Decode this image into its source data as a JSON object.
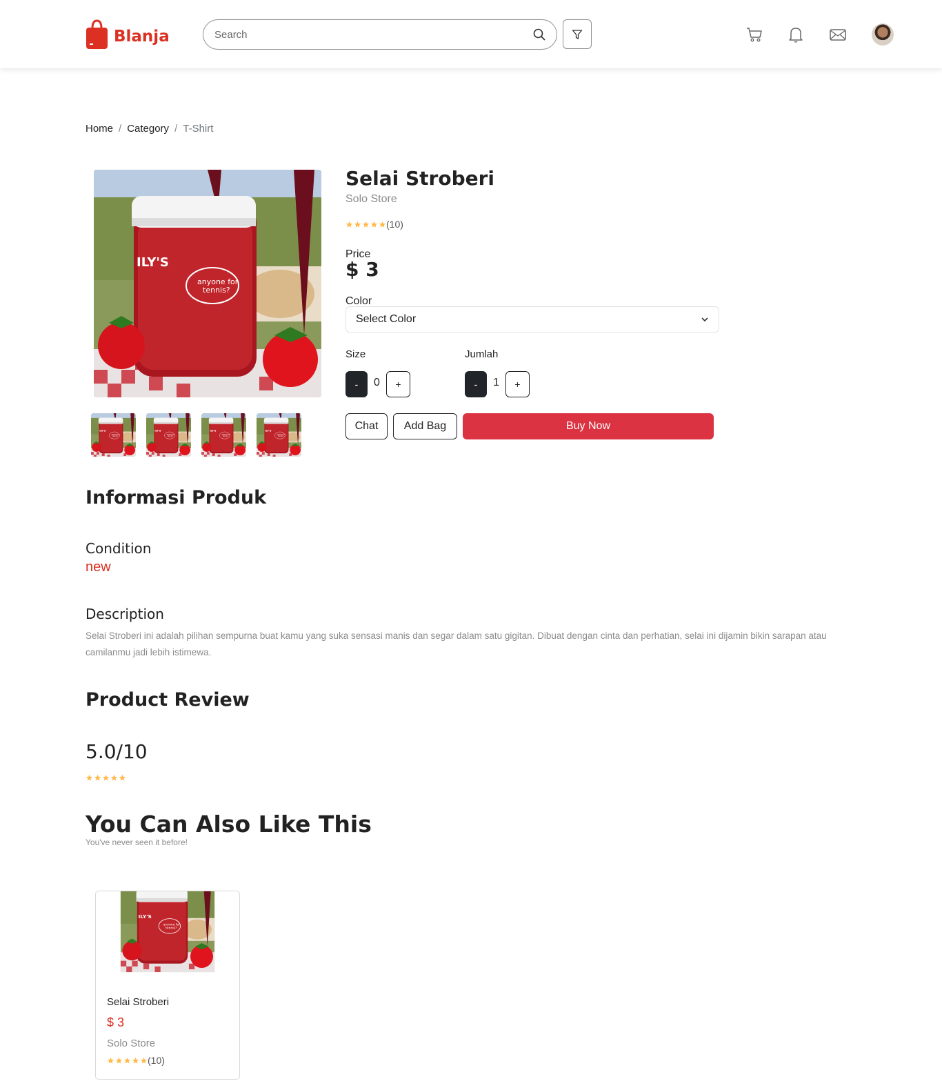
{
  "header": {
    "brand": "Blanja",
    "search": {
      "placeholder": "Search",
      "value": ""
    },
    "icons": [
      "shopping-bag-icon",
      "search-icon",
      "filter-icon",
      "cart-icon",
      "bell-icon",
      "mail-icon"
    ]
  },
  "breadcrumb": {
    "home": "Home",
    "category": "Category",
    "current": "T-Shirt",
    "separator": "/"
  },
  "product": {
    "name": "Selai Stroberi",
    "store": "Solo Store",
    "rating_stars": 5,
    "rating_count": "(10)",
    "price_label": "Price",
    "price": "$ 3",
    "color_label": "Color",
    "color_select": "Select Color",
    "size_label": "Size",
    "size_value": "0",
    "qty_label": "Jumlah",
    "qty_value": "1",
    "minus": "-",
    "plus": "+",
    "chat_label": "Chat",
    "addbag_label": "Add Bag",
    "buy_label": "Buy Now"
  },
  "info": {
    "title": "Informasi Produk",
    "condition_label": "Condition",
    "condition_value": "new",
    "description_label": "Description",
    "description_text": "Selai Stroberi ini adalah pilihan sempurna buat kamu yang suka sensasi manis dan segar dalam satu gigitan. Dibuat dengan cinta dan perhatian, selai ini dijamin bikin sarapan atau camilanmu jadi lebih istimewa."
  },
  "review": {
    "title": "Product Review",
    "score": "5.0/10",
    "stars": 5
  },
  "recommend": {
    "title": "You Can Also Like This",
    "subtitle": "You've never seen it before!",
    "items": [
      {
        "name": "Selai Stroberi",
        "price": "$ 3",
        "store": "Solo Store",
        "stars": 5,
        "count": "(10)"
      }
    ]
  },
  "colors": {
    "brand": "#db3022",
    "buy": "#db3342",
    "star": "#ffba49",
    "dark_btn": "#212529"
  }
}
